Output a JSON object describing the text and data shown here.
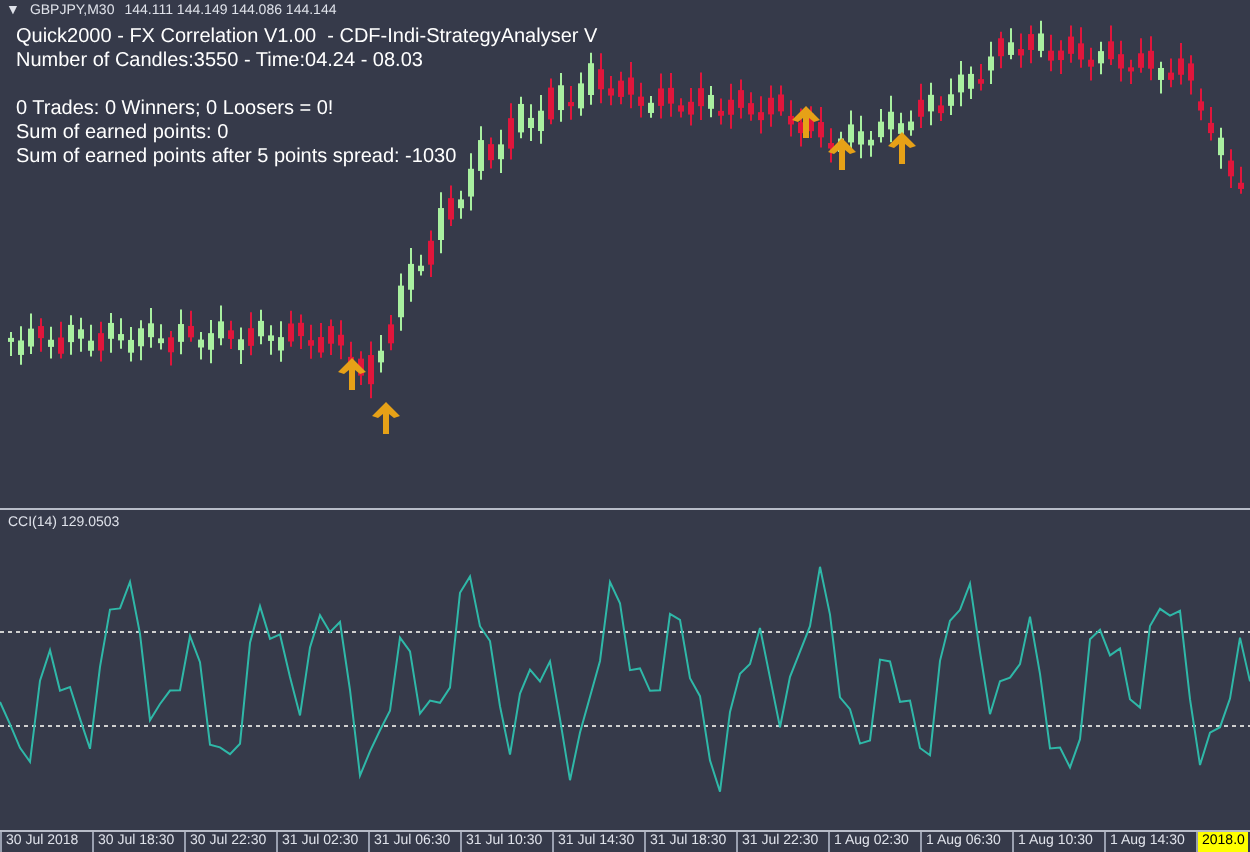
{
  "symbol_bar": {
    "toggle": "▼",
    "symbol": "GBPJPY,M30",
    "quotes": "144.111 144.149 144.086 144.144"
  },
  "info_lines": [
    "Quick2000 - FX Correlation V1.00  - CDF-Indi-StrategyAnalyser V",
    "Number of Candles:3550 - Time:04.24 - 08.03"
  ],
  "stats_lines": [
    "0 Trades: 0 Winners; 0 Loosers = 0!",
    "Sum of earned points: 0",
    "Sum of earned points after 5 points spread: -1030"
  ],
  "indicator": {
    "label": "CCI(14) 129.0503"
  },
  "time_axis": [
    {
      "label": "30 Jul 2018",
      "selected": false
    },
    {
      "label": "30 Jul 18:30",
      "selected": false
    },
    {
      "label": "30 Jul 22:30",
      "selected": false
    },
    {
      "label": "31 Jul 02:30",
      "selected": false
    },
    {
      "label": "31 Jul 06:30",
      "selected": false
    },
    {
      "label": "31 Jul 10:30",
      "selected": false
    },
    {
      "label": "31 Jul 14:30",
      "selected": false
    },
    {
      "label": "31 Jul 18:30",
      "selected": false
    },
    {
      "label": "31 Jul 22:30",
      "selected": false
    },
    {
      "label": "1 Aug 02:30",
      "selected": false
    },
    {
      "label": "1 Aug 06:30",
      "selected": false
    },
    {
      "label": "1 Aug 10:30",
      "selected": false
    },
    {
      "label": "1 Aug 14:30",
      "selected": false
    },
    {
      "label": "2018.0",
      "selected": true
    }
  ]
}
